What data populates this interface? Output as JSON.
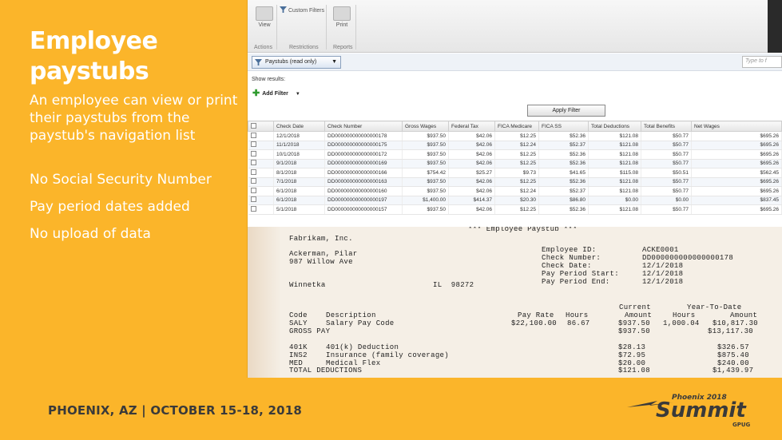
{
  "slide": {
    "title": "Employee paystubs",
    "intro": "An employee can view or print their paystubs from the paystub's navigation list",
    "bullets": [
      "No Social Security Number",
      "Pay period dates added",
      "No upload of data"
    ]
  },
  "footer": {
    "event_text": "PHOENIX, AZ  |  OCTOBER 15-18, 2018",
    "logo_top": "Phoenix 2018",
    "logo_main": "Summit",
    "logo_sub": "GPUG"
  },
  "app": {
    "ribbon": {
      "buttons": [
        {
          "label": "View",
          "icon": "view-icon"
        },
        {
          "label": "Custom Filters",
          "icon": "filter-icon"
        },
        {
          "label": "Print",
          "icon": "printer-icon"
        }
      ],
      "groups": [
        "Actions",
        "Restrictions",
        "Reports"
      ]
    },
    "view_selector": "Paystubs (read only)",
    "search_placeholder": "Type to f",
    "show_results": "Show results:",
    "add_filter": "Add Filter",
    "apply_filter": "Apply Filter",
    "table": {
      "columns": [
        "Check Date",
        "Check Number",
        "Gross Wages",
        "Federal Tax",
        "FICA Medicare",
        "FICA SS",
        "Total Deductions",
        "Total Benefits",
        "Net Wages"
      ],
      "rows": [
        [
          "12/1/2018",
          "DD000000000000000178",
          "$937.50",
          "$42.06",
          "$12.25",
          "$52.36",
          "$121.08",
          "$50.77",
          "$695.26"
        ],
        [
          "11/1/2018",
          "DD000000000000000175",
          "$937.50",
          "$42.06",
          "$12.24",
          "$52.37",
          "$121.08",
          "$50.77",
          "$695.26"
        ],
        [
          "10/1/2018",
          "DD000000000000000172",
          "$937.50",
          "$42.06",
          "$12.25",
          "$52.36",
          "$121.08",
          "$50.77",
          "$695.26"
        ],
        [
          "9/1/2018",
          "DD000000000000000169",
          "$937.50",
          "$42.06",
          "$12.25",
          "$52.36",
          "$121.08",
          "$50.77",
          "$695.26"
        ],
        [
          "8/1/2018",
          "DD000000000000000166",
          "$754.42",
          "$25.27",
          "$9.73",
          "$41.65",
          "$115.08",
          "$50.51",
          "$562.45"
        ],
        [
          "7/1/2018",
          "DD000000000000000163",
          "$937.50",
          "$42.06",
          "$12.25",
          "$52.36",
          "$121.08",
          "$50.77",
          "$695.26"
        ],
        [
          "6/1/2018",
          "DD000000000000000160",
          "$937.50",
          "$42.06",
          "$12.24",
          "$52.37",
          "$121.08",
          "$50.77",
          "$695.26"
        ],
        [
          "6/1/2018",
          "DD000000000000000197",
          "$1,400.00",
          "$414.37",
          "$20.30",
          "$86.80",
          "$0.00",
          "$0.00",
          "$837.45"
        ],
        [
          "5/1/2018",
          "DD000000000000000157",
          "$937.50",
          "$42.06",
          "$12.25",
          "$52.36",
          "$121.08",
          "$50.77",
          "$695.26"
        ]
      ]
    }
  },
  "stub": {
    "header": "*** Employee Paystub ***",
    "company": "Fabrikam, Inc.",
    "employee_name": "Ackerman, Pilar",
    "address": "987 Willow Ave",
    "city": "Winnetka",
    "state_zip": "IL  98272",
    "labels": {
      "employee_id": "Employee ID:",
      "check_number": "Check Number:",
      "check_date": "Check Date:",
      "period_start": "Pay Period Start:",
      "period_end": "Pay Period End:"
    },
    "values": {
      "employee_id": "ACKE0001",
      "check_number": "DD000000000000000178",
      "check_date": "12/1/2018",
      "period_start": "12/1/2018",
      "period_end": "12/1/2018"
    },
    "col_group_current": "Current",
    "col_group_ytd": "Year-To-Date",
    "col_headers": {
      "code": "Code",
      "description": "Description",
      "pay_rate": "Pay Rate",
      "hours": "Hours",
      "amount": "Amount",
      "ytd_hours": "Hours",
      "ytd_amount": "Amount"
    },
    "earnings": {
      "code": "SALY",
      "description": "Salary Pay Code",
      "pay_rate": "$22,100.00",
      "hours": "86.67",
      "amount": "$937.50",
      "ytd_hours": "1,000.04",
      "ytd_amount": "$10,817.30"
    },
    "gross_label": "GROSS PAY",
    "gross_current": "$937.50",
    "gross_ytd": "$13,117.30",
    "deductions": [
      {
        "code": "401K",
        "description": "401(k) Deduction",
        "current": "$28.13",
        "ytd": "$326.57"
      },
      {
        "code": "INS2",
        "description": "Insurance (family coverage)",
        "current": "$72.95",
        "ytd": "$875.40"
      },
      {
        "code": "MED",
        "description": "Medical Flex",
        "current": "$20.00",
        "ytd": "$240.00"
      }
    ],
    "total_label": "TOTAL DEDUCTIONS",
    "total_current": "$121.08",
    "total_ytd": "$1,439.97"
  }
}
